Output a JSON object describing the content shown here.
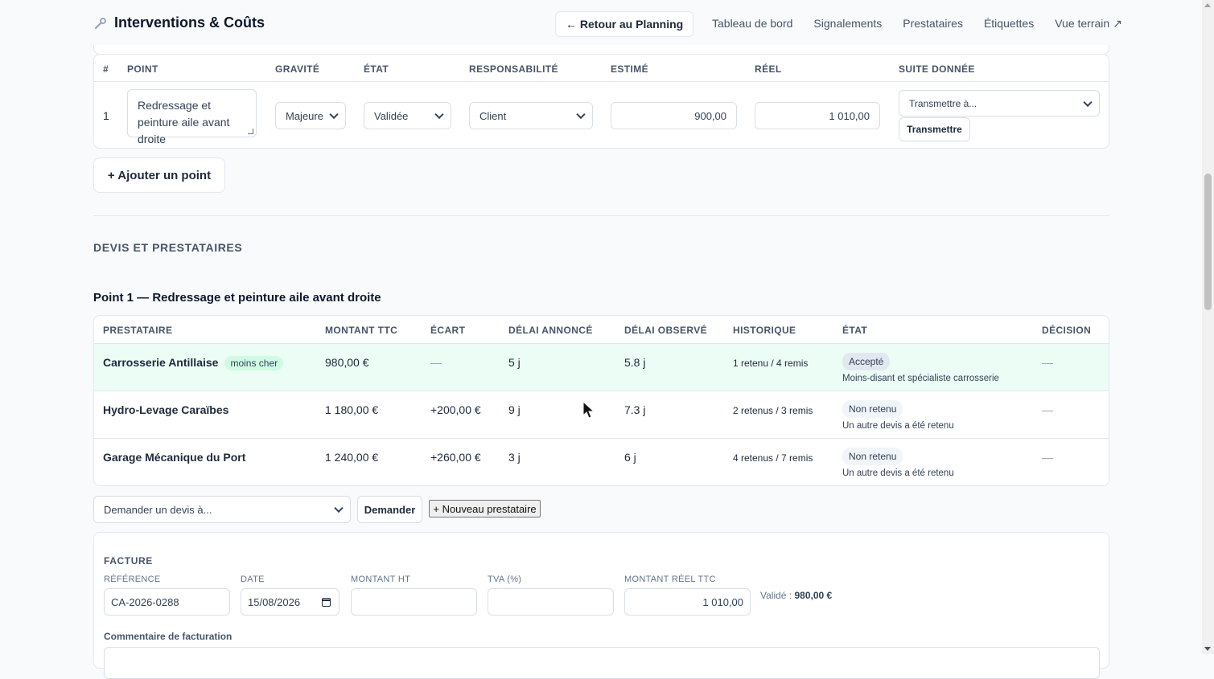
{
  "header": {
    "title": "Interventions & Coûts",
    "back_button": "← Retour au Planning",
    "nav": [
      "Tableau de bord",
      "Signalements",
      "Prestataires",
      "Étiquettes",
      "Vue terrain ↗"
    ]
  },
  "points_table": {
    "columns": [
      "#",
      "POINT",
      "GRAVITÉ",
      "ÉTAT",
      "RESPONSABILITÉ",
      "ESTIMÉ",
      "RÉEL",
      "SUITE DONNÉE"
    ],
    "rows": [
      {
        "index": "1",
        "point": "Redressage et peinture aile avant droite",
        "gravite": "Majeure",
        "etat": "Validée",
        "responsabilite": "Client",
        "estime": "900,00",
        "reel": "1 010,00",
        "suite_select": "Transmettre à...",
        "suite_button": "Transmettre"
      }
    ]
  },
  "add_point_button": "+ Ajouter un point",
  "quotes_section": {
    "title": "DEVIS ET PRESTATAIRES",
    "point_title": "Point 1 — Redressage et peinture aile avant droite",
    "columns": [
      "PRESTATAIRE",
      "MONTANT TTC",
      "ÉCART",
      "DÉLAI ANNONCÉ",
      "DÉLAI OBSERVÉ",
      "HISTORIQUE",
      "ÉTAT",
      "DÉCISION"
    ],
    "rows": [
      {
        "prestataire": "Carrosserie Antillaise",
        "tag": "moins cher",
        "montant": "980,00 €",
        "ecart": "—",
        "delai_annonce": "5 j",
        "delai_observe": "5.8 j",
        "historique": "1 retenu / 4 remis",
        "etat": "Accepté",
        "motif": "Moins-disant et spécialiste carrosserie",
        "decision": "—"
      },
      {
        "prestataire": "Hydro-Levage Caraïbes",
        "tag": "",
        "montant": "1 180,00 €",
        "ecart": "+200,00 €",
        "delai_annonce": "9 j",
        "delai_observe": "7.3 j",
        "historique": "2 retenus / 3 remis",
        "etat": "Non retenu",
        "motif": "Un autre devis a été retenu",
        "decision": "—"
      },
      {
        "prestataire": "Garage Mécanique du Port",
        "tag": "",
        "montant": "1 240,00 €",
        "ecart": "+260,00 €",
        "delai_annonce": "3 j",
        "delai_observe": "6 j",
        "historique": "4 retenus / 7 remis",
        "etat": "Non retenu",
        "motif": "Un autre devis a été retenu",
        "decision": "—"
      }
    ],
    "request_select": "Demander un devis à...",
    "request_button": "Demander",
    "new_provider_button": "+ Nouveau prestataire"
  },
  "invoice": {
    "title": "FACTURE",
    "labels": {
      "reference": "RÉFÉRENCE",
      "date": "DATE",
      "montant_ht": "MONTANT HT",
      "tva": "TVA (%)",
      "montant_reel": "MONTANT RÉEL TTC"
    },
    "reference": "CA-2026-0288",
    "date": "15/08/2026",
    "montant_ht": "",
    "tva": "",
    "montant_reel": "1 010,00",
    "validated_label": "Validé :",
    "validated_value": "980,00 €",
    "comment_label": "Commentaire de facturation"
  },
  "colors": {
    "accepted_row": "#ecfdf5",
    "cheaper_tag": "#d1fae5",
    "border": "#e2e8f0"
  }
}
